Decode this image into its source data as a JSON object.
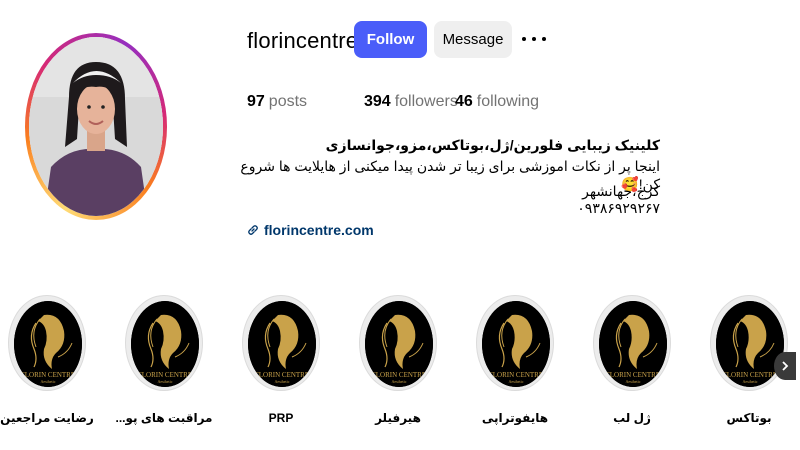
{
  "profile": {
    "username": "florincentre",
    "follow_label": "Follow",
    "message_label": "Message",
    "stats": {
      "posts_count": "97",
      "posts_label": "posts",
      "followers_count": "394",
      "followers_label": "followers",
      "following_count": "46",
      "following_label": "following"
    },
    "bio": {
      "name": "کلینیک زیبایی فلورین/ژل،بوتاکس،مزو،جوانسازی",
      "line1": "اینجا پر از نکات اموزشی برای زیبا تر شدن پیدا میکنی از هایلایت ها شروع کن!🥰",
      "line2": "کرج،جهانشهر",
      "line3": "۰۹۳۸۶۹۲۹۲۶۷",
      "link": "florincentre.com"
    }
  },
  "highlights": [
    {
      "label": "رضایت مراجعین"
    },
    {
      "label": "مراقبت های پو..."
    },
    {
      "label": "PRP"
    },
    {
      "label": "هیرفیلر"
    },
    {
      "label": "هایفوتراپی"
    },
    {
      "label": "ژل لب"
    },
    {
      "label": "بوتاکس"
    }
  ],
  "highlight_logo_text": "FLORIN CENTRE",
  "highlight_logo_sub": "Aesthetic",
  "colors": {
    "follow_button": "#4a5df9",
    "link": "#00376b",
    "gold": "#c9a24a"
  }
}
